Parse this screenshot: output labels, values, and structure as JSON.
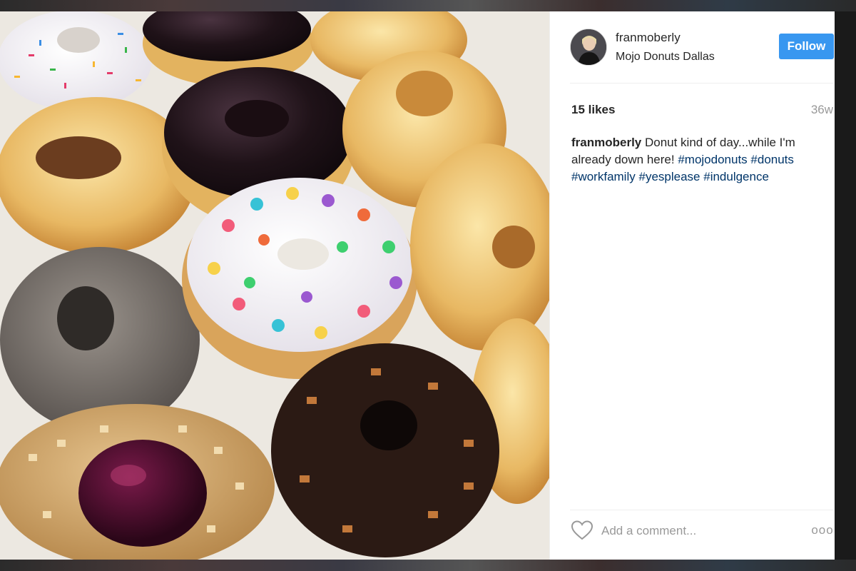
{
  "post": {
    "username": "franmoberly",
    "location": "Mojo Donuts Dallas",
    "follow_label": "Follow",
    "likes": "15 likes",
    "age": "36w",
    "caption": {
      "user": "franmoberly",
      "text": " Donut kind of day...while I'm already down here! ",
      "tags": [
        "#mojodonuts",
        "#donuts",
        "#workfamily",
        "#yesplease",
        "#indulgence"
      ]
    },
    "comment_placeholder": "Add a comment...",
    "more_label": "ooo"
  },
  "icons": {
    "like": "heart-outline-icon",
    "more": "more-options-icon"
  },
  "colors": {
    "follow_button": "#3897f0",
    "hashtag": "#003569",
    "text": "#262626",
    "muted": "#999999"
  }
}
